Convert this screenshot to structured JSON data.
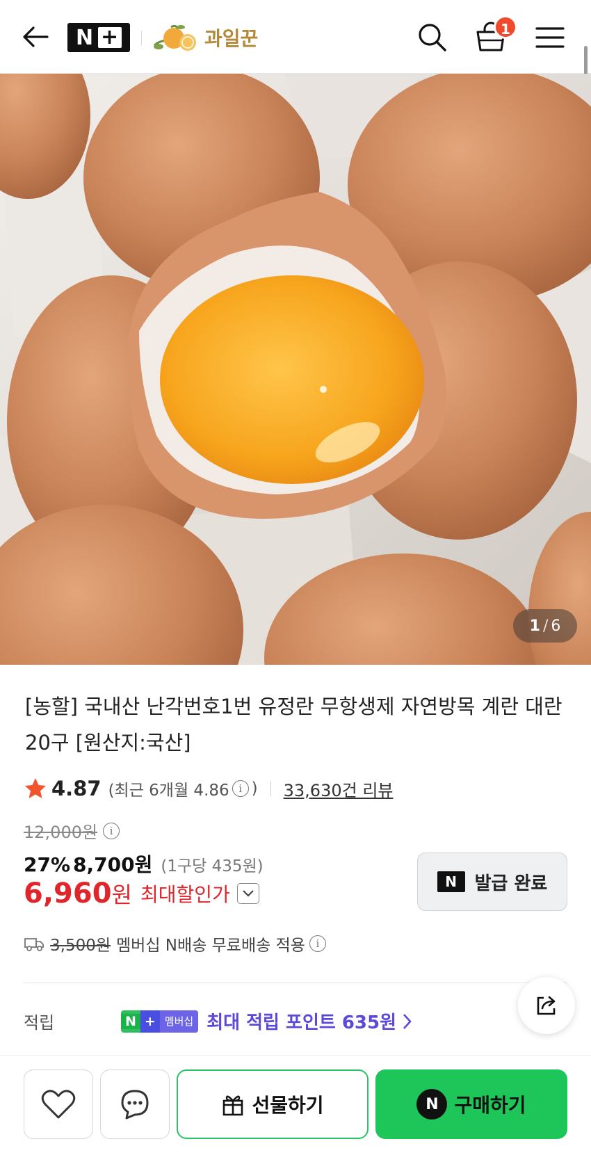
{
  "header": {
    "brand_badge": "N",
    "brand_plus": "+",
    "store_name": "과일꾼",
    "cart_count": "1"
  },
  "gallery": {
    "current": "1",
    "separator": "/",
    "total": "6"
  },
  "product": {
    "title": "[농할] 국내산 난각번호1번 유정란 무항생제 자연방목 계란 대란 20구 [원산지:국산]",
    "rating": "4.87",
    "recent_rating_prefix": "(최근 6개월 4.86",
    "recent_rating_suffix": ")",
    "review_count": "33,630건 리뷰",
    "original_price": "12,000원",
    "discount_rate": "27%",
    "discount_price": "8,700원",
    "unit_price": "(1구당 435원)",
    "max_price_value": "6,960",
    "max_price_unit": "원",
    "max_discount_label": "최대할인가"
  },
  "coupon": {
    "badge": "N",
    "label": "발급 완료"
  },
  "shipping": {
    "original_fee": "3,500원",
    "text": "멤버십 N배송 무료배송 적용"
  },
  "points": {
    "label": "적립",
    "badge_n": "N",
    "badge_plus": "+",
    "badge_membership": "멤버십",
    "text": "최대 적립 포인트 635원"
  },
  "bottom_bar": {
    "gift_label": "선물하기",
    "buy_badge": "N",
    "buy_label": "구매하기"
  },
  "colors": {
    "sale_red": "#e0252b",
    "npay_green": "#1ec65a",
    "point_purple": "#5b4ad9",
    "badge_orange": "#f04a2d"
  }
}
